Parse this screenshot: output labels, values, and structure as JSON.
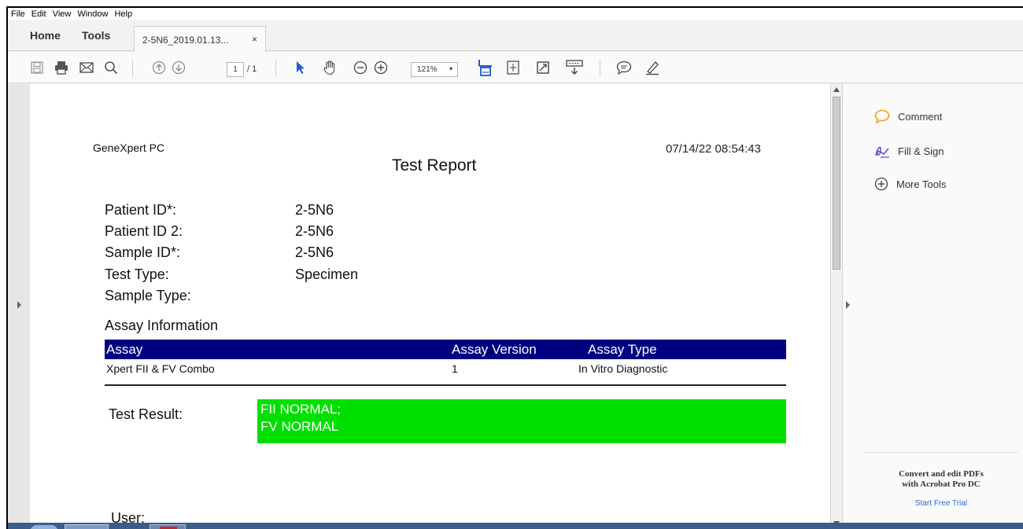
{
  "menu": [
    "File",
    "Edit",
    "View",
    "Window",
    "Help"
  ],
  "tabs": {
    "home": "Home",
    "tools": "Tools",
    "doc": "2-5N6_2019.01.13...",
    "close": "×"
  },
  "toolbar": {
    "page_current": "1",
    "page_total": "/ 1",
    "zoom": "121%",
    "zoom_caret": "▾"
  },
  "panel": {
    "comment": "Comment",
    "fill_sign": "Fill & Sign",
    "more_tools": "More Tools",
    "promo_line1": "Convert and edit PDFs",
    "promo_line2": "with Acrobat Pro DC",
    "trial": "Start Free Trial",
    "accent_color": "#f0a30a",
    "fill_color": "#6b4bd6"
  },
  "report": {
    "system": "GeneXpert PC",
    "timestamp": "07/14/22  08:54:43",
    "title": "Test Report",
    "fields": [
      {
        "label": "Patient ID*:",
        "value": "2-5N6"
      },
      {
        "label": "Patient ID 2:",
        "value": "2-5N6"
      },
      {
        "label": "Sample ID*:",
        "value": "2-5N6"
      },
      {
        "label": "Test Type:",
        "value": "Specimen"
      },
      {
        "label": "Sample Type:",
        "value": ""
      }
    ],
    "assay_section": "Assay Information",
    "assay_headers": {
      "assay": "Assay",
      "version": "Assay Version",
      "type": "Assay Type"
    },
    "assay_row": {
      "assay": "Xpert FII & FV Combo",
      "version": "1",
      "type": "In Vitro Diagnostic"
    },
    "result_label": "Test Result:",
    "result_line1": "FII NORMAL;",
    "result_line2": "FV NORMAL",
    "result_color": "#00e000",
    "header_color": "#000080",
    "user_label": "User:"
  }
}
